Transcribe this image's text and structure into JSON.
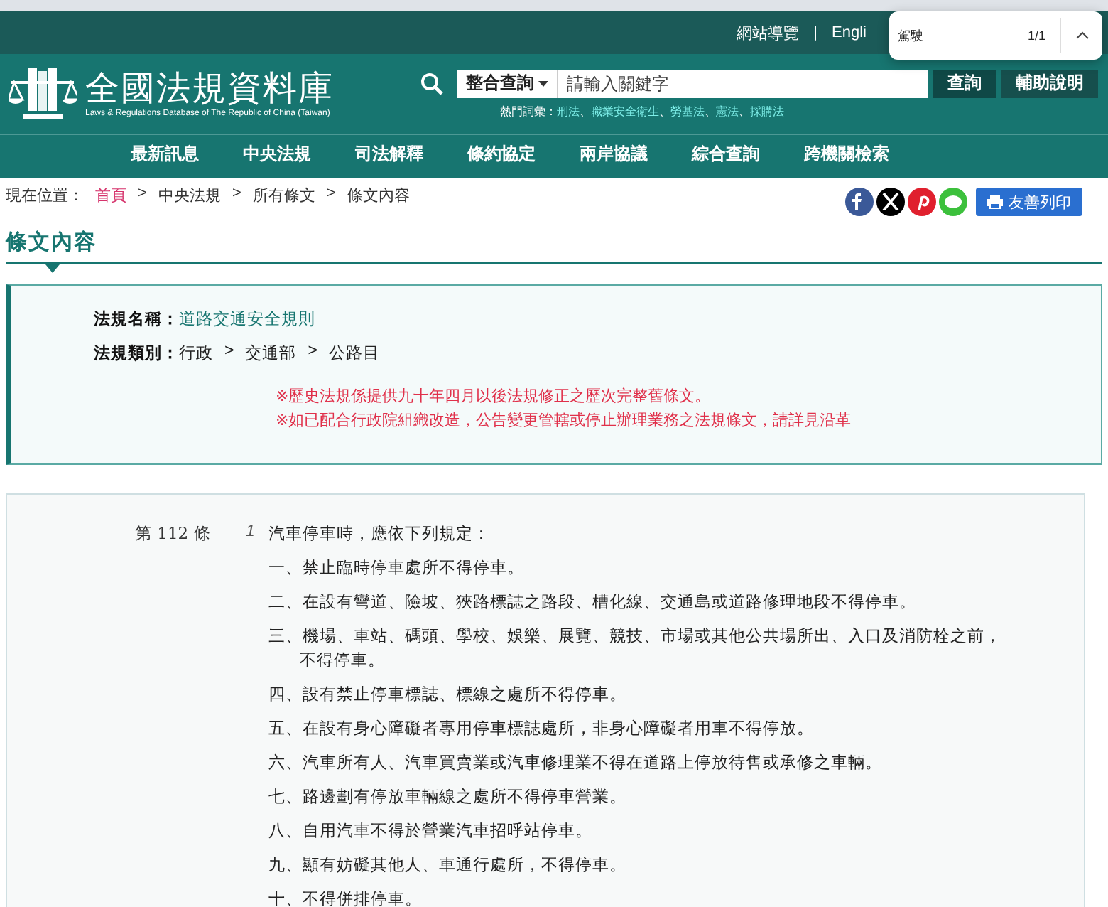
{
  "top_bar": {
    "links": [
      "網站導覽",
      "Engli"
    ],
    "separator": "|"
  },
  "find_popup": {
    "query": "駕駛",
    "count": "1/1"
  },
  "header": {
    "logo_title": "全國法規資料庫",
    "logo_subtitle": "Laws & Regulations Database of The Republic of China (Taiwan)",
    "search_scope": "整合查詢",
    "search_placeholder": "請輸入關鍵字",
    "search_button": "查詢",
    "help_button": "輔助說明",
    "hot_label": "熱門詞彙：",
    "term_separator": "、",
    "hot_terms": [
      "刑法",
      "職業安全衛生",
      "勞基法",
      "憲法",
      "採購法"
    ]
  },
  "nav": [
    "最新訊息",
    "中央法規",
    "司法解釋",
    "條約協定",
    "兩岸協議",
    "綜合查詢",
    "跨機關檢索"
  ],
  "breadcrumb": {
    "label": "現在位置：",
    "separator": ">",
    "items": [
      {
        "text": "首頁",
        "link": true
      },
      {
        "text": "中央法規",
        "link": false
      },
      {
        "text": "所有條文",
        "link": false
      },
      {
        "text": "條文內容",
        "link": false
      }
    ]
  },
  "share": [
    {
      "kind": "facebook",
      "color": "#3b5998"
    },
    {
      "kind": "x",
      "color": "#000000"
    },
    {
      "kind": "pinterest",
      "color": "#e0202e"
    },
    {
      "kind": "line",
      "color": "#3cc03c"
    }
  ],
  "print_button": "友善列印",
  "section_title": "條文內容",
  "info": {
    "name_label": "法規名稱：",
    "name": "道路交通安全規則",
    "category_label": "法規類別：",
    "category_separator": ">",
    "categories": [
      "行政",
      "交通部",
      "公路目"
    ],
    "notes": [
      "※歷史法規係提供九十年四月以後法規修正之歷次完整舊條文。",
      "※如已配合行政院組織改造，公告變更管轄或停止辦理業務之法規條文，請詳見沿革"
    ]
  },
  "article": {
    "number": "第 112 條",
    "paragraph": "1",
    "intro": "汽車停車時，應依下列規定：",
    "items": [
      "一、禁止臨時停車處所不得停車。",
      "二、在設有彎道、險坡、狹路標誌之路段、槽化線、交通島或道路修理地段不得停車。",
      "三、機場、車站、碼頭、學校、娛樂、展覽、競技、市場或其他公共場所出、入口及消防栓之前，不得停車。",
      "四、設有禁止停車標誌、標線之處所不得停車。",
      "五、在設有身心障礙者專用停車標誌處所，非身心障礙者用車不得停放。",
      "六、汽車所有人、汽車買賣業或汽車修理業不得在道路上停放待售或承修之車輛。",
      "七、路邊劃有停放車輛線之處所不得停車營業。",
      "八、自用汽車不得於營業汽車招呼站停車。",
      "九、顯有妨礙其他人、車通行處所，不得停車。",
      "十、不得併排停車。"
    ]
  }
}
